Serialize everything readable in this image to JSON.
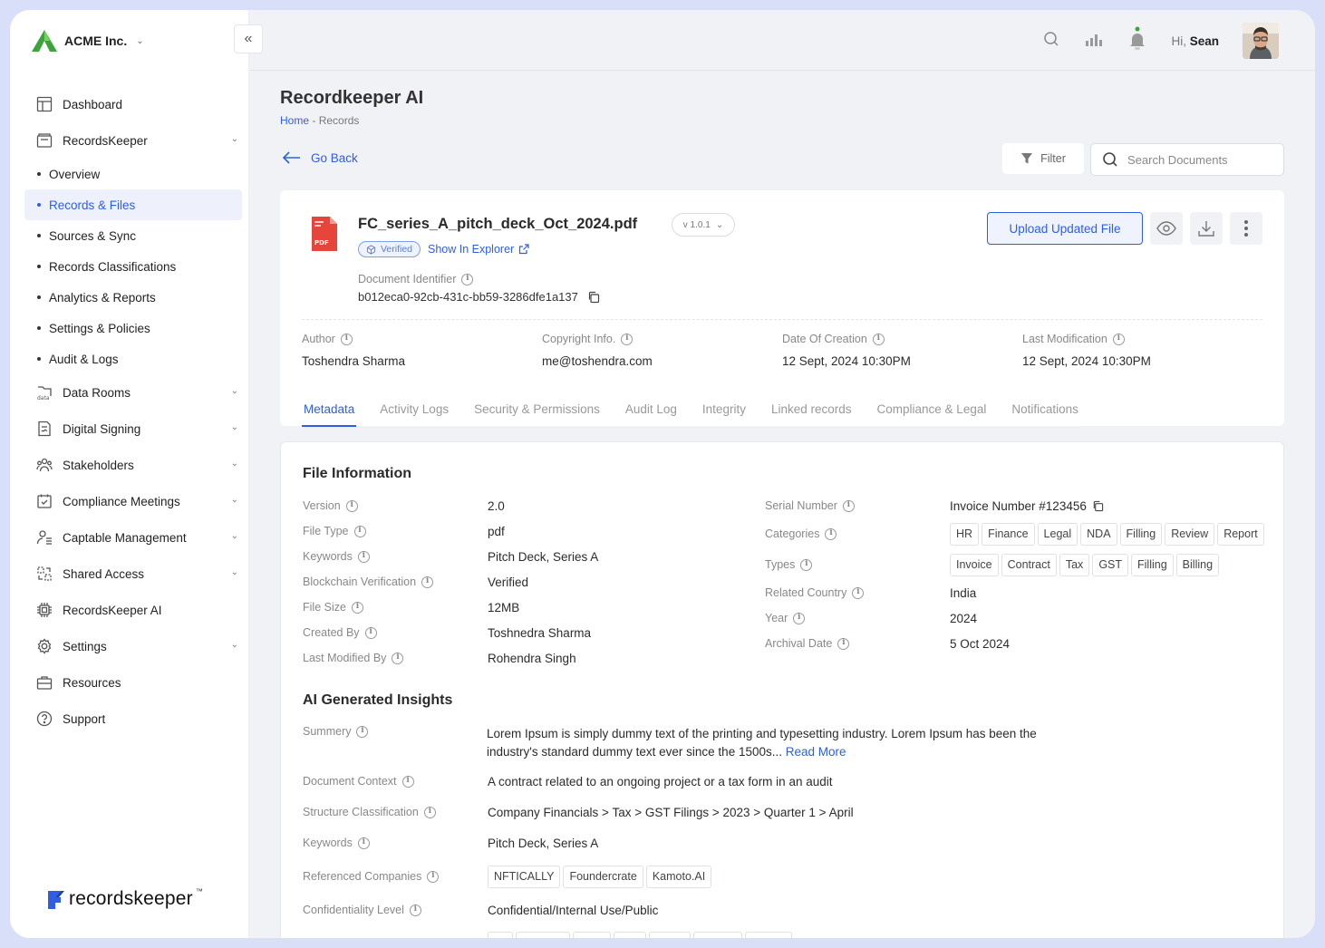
{
  "brand": {
    "name": "ACME Inc."
  },
  "sidebar": {
    "items": [
      {
        "label": "Dashboard",
        "icon": "dashboard-icon"
      },
      {
        "label": "RecordsKeeper",
        "icon": "records-icon",
        "expanded": true,
        "children": [
          "Overview",
          "Records & Files",
          "Sources & Sync",
          "Records Classifications",
          "Analytics & Reports",
          "Settings & Policies",
          "Audit & Logs"
        ]
      },
      {
        "label": "Data Rooms",
        "icon": "data-rooms-icon"
      },
      {
        "label": "Digital Signing",
        "icon": "signing-icon"
      },
      {
        "label": "Stakeholders",
        "icon": "stakeholders-icon"
      },
      {
        "label": "Compliance Meetings",
        "icon": "calendar-icon"
      },
      {
        "label": "Captable Management",
        "icon": "captable-icon"
      },
      {
        "label": "Shared Access",
        "icon": "share-icon"
      },
      {
        "label": "RecordsKeeper AI",
        "icon": "ai-chip-icon"
      },
      {
        "label": "Settings",
        "icon": "gear-icon"
      },
      {
        "label": "Resources",
        "icon": "briefcase-icon"
      },
      {
        "label": "Support",
        "icon": "help-icon"
      }
    ],
    "active_child": "Records & Files",
    "footer_logo": "recordskeeper"
  },
  "header": {
    "greeting": "Hi,",
    "user": "Sean"
  },
  "page": {
    "title": "Recordkeeper AI",
    "breadcrumb": {
      "home": "Home",
      "separator": "-",
      "current": "Records"
    },
    "go_back": "Go Back",
    "filter": "Filter",
    "search_placeholder": "Search Documents"
  },
  "document": {
    "name": "FC_series_A_pitch_deck_Oct_2024.pdf",
    "version": "v 1.0.1",
    "verified": "Verified",
    "show_in_explorer": "Show In Explorer",
    "identifier_label": "Document Identifier",
    "identifier": "b012eca0-92cb-431c-bb59-3286dfe1a137",
    "upload_button": "Upload Updated File",
    "meta": [
      {
        "label": "Author",
        "value": "Toshendra Sharma"
      },
      {
        "label": "Copyright Info.",
        "value": "me@toshendra.com"
      },
      {
        "label": "Date Of Creation",
        "value": "12 Sept, 2024 10:30PM"
      },
      {
        "label": "Last Modification",
        "value": "12 Sept, 2024 10:30PM"
      }
    ],
    "tabs": [
      "Metadata",
      "Activity Logs",
      "Security & Permissions",
      "Audit Log",
      "Integrity",
      "Linked records",
      "Compliance & Legal",
      "Notifications"
    ],
    "active_tab": "Metadata"
  },
  "file_info": {
    "heading": "File Information",
    "left": [
      {
        "label": "Version",
        "value": "2.0"
      },
      {
        "label": "File Type",
        "value": "pdf"
      },
      {
        "label": "Keywords",
        "value": "Pitch Deck, Series A"
      },
      {
        "label": "Blockchain Verification",
        "value": "Verified"
      },
      {
        "label": "File Size",
        "value": "12MB"
      },
      {
        "label": "Created By",
        "value": "Toshnedra Sharma"
      },
      {
        "label": "Last Modified By",
        "value": "Rohendra Singh"
      }
    ],
    "serial_label": "Serial Number",
    "serial_value": "Invoice Number #123456",
    "categories_label": "Categories",
    "categories": [
      "HR",
      "Finance",
      "Legal",
      "NDA",
      "Filling",
      "Review",
      "Report"
    ],
    "types_label": "Types",
    "types": [
      "Invoice",
      "Contract",
      "Tax",
      "GST",
      "Filling",
      "Billing"
    ],
    "right_rest": [
      {
        "label": "Related Country",
        "value": "India"
      },
      {
        "label": "Year",
        "value": "2024"
      },
      {
        "label": "Archival Date",
        "value": "5 Oct 2024"
      }
    ]
  },
  "insights": {
    "heading": "AI Generated Insights",
    "summary_label": "Summery",
    "summary": "Lorem Ipsum is simply dummy text of the printing and typesetting industry. Lorem Ipsum has been the industry's standard dummy text ever since the 1500s...",
    "read_more": "Read More",
    "rows": [
      {
        "label": "Document Context",
        "value": "A contract related to an ongoing project or a tax form in an audit"
      },
      {
        "label": "Structure Classification",
        "value": "Company Financials > Tax > GST Filings > 2023 > Quarter 1 > April"
      },
      {
        "label": "Keywords",
        "value": "Pitch Deck, Series A"
      }
    ],
    "companies_label": "Referenced Companies",
    "companies": [
      "NFTICALLY",
      "Foundercrate",
      "Kamoto.AI"
    ],
    "confidentiality_label": "Confidentiality Level",
    "confidentiality": "Confidential/Internal Use/Public"
  },
  "colors": {
    "accent": "#2f5fe0",
    "brand_green": "#3ba53b",
    "pdf_red": "#e5453b"
  }
}
